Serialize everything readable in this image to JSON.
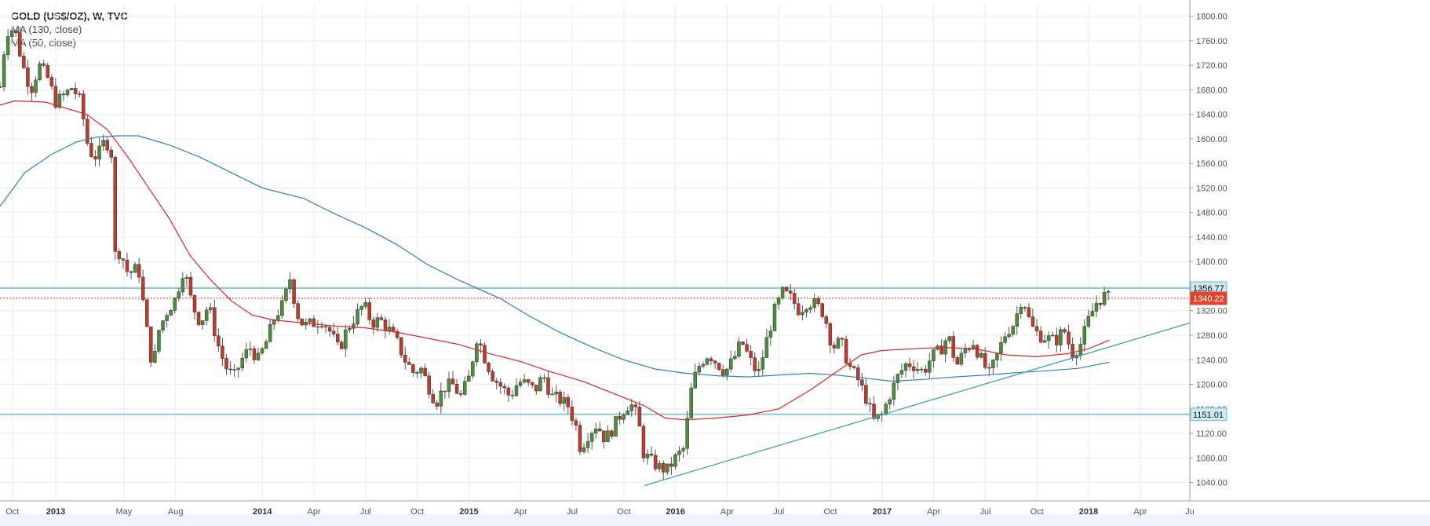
{
  "legend": {
    "title": "GOLD (US$/OZ), W, TVC",
    "ma1": "MA (130, close)",
    "ma2": "MA (50, close)"
  },
  "chart_data": {
    "type": "candlestick",
    "symbol": "GOLD (US$/OZ)",
    "interval": "W",
    "source": "TVC",
    "ylim": [
      1010,
      1820
    ],
    "yticks": [
      1040,
      1080,
      1120,
      1160,
      1200,
      1240,
      1280,
      1320,
      1360,
      1400,
      1440,
      1480,
      1520,
      1560,
      1600,
      1640,
      1680,
      1720,
      1760,
      1800
    ],
    "ytick_labels": [
      "1040.00",
      "1080.00",
      "1120.00",
      "1160.00",
      "1200.00",
      "1240.00",
      "1280.00",
      "1320.00",
      "1360.00",
      "1400.00",
      "1440.00",
      "1480.00",
      "1520.00",
      "1560.00",
      "1600.00",
      "1640.00",
      "1680.00",
      "1720.00",
      "1760.00",
      "1800.00"
    ],
    "xlim": [
      2012.73,
      2018.49
    ],
    "xticks": [
      {
        "t": 2012.79,
        "label": "Oct",
        "year": false
      },
      {
        "t": 2013.0,
        "label": "2013",
        "year": true
      },
      {
        "t": 2013.33,
        "label": "May",
        "year": false
      },
      {
        "t": 2013.58,
        "label": "Aug",
        "year": false
      },
      {
        "t": 2014.0,
        "label": "2014",
        "year": true
      },
      {
        "t": 2014.25,
        "label": "Apr",
        "year": false
      },
      {
        "t": 2014.5,
        "label": "Jul",
        "year": false
      },
      {
        "t": 2014.75,
        "label": "Oct",
        "year": false
      },
      {
        "t": 2015.0,
        "label": "2015",
        "year": true
      },
      {
        "t": 2015.25,
        "label": "Apr",
        "year": false
      },
      {
        "t": 2015.5,
        "label": "Jul",
        "year": false
      },
      {
        "t": 2015.75,
        "label": "Oct",
        "year": false
      },
      {
        "t": 2016.0,
        "label": "2016",
        "year": true
      },
      {
        "t": 2016.25,
        "label": "Apr",
        "year": false
      },
      {
        "t": 2016.5,
        "label": "Jul",
        "year": false
      },
      {
        "t": 2016.75,
        "label": "Oct",
        "year": false
      },
      {
        "t": 2017.0,
        "label": "2017",
        "year": true
      },
      {
        "t": 2017.25,
        "label": "Apr",
        "year": false
      },
      {
        "t": 2017.5,
        "label": "Jul",
        "year": false
      },
      {
        "t": 2017.75,
        "label": "Oct",
        "year": false
      },
      {
        "t": 2018.0,
        "label": "2018",
        "year": true
      },
      {
        "t": 2018.25,
        "label": "Apr",
        "year": false
      },
      {
        "t": 2018.49,
        "label": "Ju",
        "year": false
      }
    ],
    "close_path": [
      [
        2012.73,
        1685
      ],
      [
        2012.76,
        1775
      ],
      [
        2012.8,
        1780
      ],
      [
        2012.84,
        1720
      ],
      [
        2012.88,
        1680
      ],
      [
        2012.92,
        1720
      ],
      [
        2012.96,
        1700
      ],
      [
        2013.0,
        1660
      ],
      [
        2013.04,
        1670
      ],
      [
        2013.08,
        1685
      ],
      [
        2013.12,
        1660
      ],
      [
        2013.16,
        1580
      ],
      [
        2013.2,
        1570
      ],
      [
        2013.24,
        1600
      ],
      [
        2013.27,
        1575
      ],
      [
        2013.29,
        1390
      ],
      [
        2013.31,
        1420
      ],
      [
        2013.35,
        1380
      ],
      [
        2013.4,
        1390
      ],
      [
        2013.44,
        1290
      ],
      [
        2013.47,
        1225
      ],
      [
        2013.5,
        1290
      ],
      [
        2013.54,
        1320
      ],
      [
        2013.58,
        1340
      ],
      [
        2013.62,
        1390
      ],
      [
        2013.66,
        1330
      ],
      [
        2013.7,
        1300
      ],
      [
        2013.74,
        1330
      ],
      [
        2013.78,
        1270
      ],
      [
        2013.82,
        1230
      ],
      [
        2013.86,
        1210
      ],
      [
        2013.9,
        1240
      ],
      [
        2013.94,
        1260
      ],
      [
        2013.98,
        1240
      ],
      [
        2014.02,
        1270
      ],
      [
        2014.06,
        1310
      ],
      [
        2014.1,
        1330
      ],
      [
        2014.14,
        1380
      ],
      [
        2014.16,
        1320
      ],
      [
        2014.2,
        1295
      ],
      [
        2014.25,
        1300
      ],
      [
        2014.29,
        1305
      ],
      [
        2014.33,
        1285
      ],
      [
        2014.37,
        1255
      ],
      [
        2014.41,
        1290
      ],
      [
        2014.45,
        1310
      ],
      [
        2014.49,
        1330
      ],
      [
        2014.53,
        1300
      ],
      [
        2014.57,
        1305
      ],
      [
        2014.61,
        1290
      ],
      [
        2014.65,
        1270
      ],
      [
        2014.69,
        1240
      ],
      [
        2014.73,
        1220
      ],
      [
        2014.77,
        1225
      ],
      [
        2014.8,
        1200
      ],
      [
        2014.84,
        1170
      ],
      [
        2014.88,
        1195
      ],
      [
        2014.92,
        1200
      ],
      [
        2014.96,
        1180
      ],
      [
        2015.0,
        1210
      ],
      [
        2015.04,
        1280
      ],
      [
        2015.08,
        1240
      ],
      [
        2015.12,
        1210
      ],
      [
        2015.16,
        1195
      ],
      [
        2015.2,
        1180
      ],
      [
        2015.24,
        1205
      ],
      [
        2015.28,
        1200
      ],
      [
        2015.32,
        1190
      ],
      [
        2015.36,
        1215
      ],
      [
        2015.4,
        1180
      ],
      [
        2015.44,
        1175
      ],
      [
        2015.48,
        1165
      ],
      [
        2015.52,
        1130
      ],
      [
        2015.54,
        1095
      ],
      [
        2015.58,
        1120
      ],
      [
        2015.62,
        1135
      ],
      [
        2015.66,
        1110
      ],
      [
        2015.7,
        1130
      ],
      [
        2015.74,
        1155
      ],
      [
        2015.78,
        1170
      ],
      [
        2015.82,
        1145
      ],
      [
        2015.84,
        1090
      ],
      [
        2015.88,
        1075
      ],
      [
        2015.92,
        1065
      ],
      [
        2015.96,
        1060
      ],
      [
        2016.0,
        1080
      ],
      [
        2016.04,
        1095
      ],
      [
        2016.08,
        1200
      ],
      [
        2016.12,
        1235
      ],
      [
        2016.16,
        1250
      ],
      [
        2016.2,
        1235
      ],
      [
        2016.24,
        1220
      ],
      [
        2016.28,
        1240
      ],
      [
        2016.32,
        1270
      ],
      [
        2016.36,
        1240
      ],
      [
        2016.4,
        1215
      ],
      [
        2016.44,
        1270
      ],
      [
        2016.48,
        1320
      ],
      [
        2016.52,
        1350
      ],
      [
        2016.56,
        1340
      ],
      [
        2016.6,
        1320
      ],
      [
        2016.64,
        1335
      ],
      [
        2016.68,
        1330
      ],
      [
        2016.72,
        1315
      ],
      [
        2016.76,
        1260
      ],
      [
        2016.8,
        1270
      ],
      [
        2016.84,
        1230
      ],
      [
        2016.88,
        1210
      ],
      [
        2016.92,
        1180
      ],
      [
        2016.96,
        1140
      ],
      [
        2017.0,
        1150
      ],
      [
        2017.04,
        1185
      ],
      [
        2017.08,
        1215
      ],
      [
        2017.12,
        1235
      ],
      [
        2017.16,
        1230
      ],
      [
        2017.2,
        1220
      ],
      [
        2017.24,
        1245
      ],
      [
        2017.28,
        1255
      ],
      [
        2017.32,
        1280
      ],
      [
        2017.36,
        1230
      ],
      [
        2017.4,
        1255
      ],
      [
        2017.44,
        1270
      ],
      [
        2017.48,
        1240
      ],
      [
        2017.52,
        1215
      ],
      [
        2017.56,
        1250
      ],
      [
        2017.6,
        1285
      ],
      [
        2017.64,
        1300
      ],
      [
        2017.68,
        1345
      ],
      [
        2017.72,
        1295
      ],
      [
        2017.76,
        1280
      ],
      [
        2017.8,
        1275
      ],
      [
        2017.84,
        1270
      ],
      [
        2017.88,
        1290
      ],
      [
        2017.92,
        1250
      ],
      [
        2017.96,
        1265
      ],
      [
        2018.0,
        1305
      ],
      [
        2018.04,
        1335
      ],
      [
        2018.08,
        1345
      ],
      [
        2018.1,
        1340
      ]
    ],
    "ma130": [
      [
        2012.73,
        1490
      ],
      [
        2012.85,
        1545
      ],
      [
        2012.98,
        1575
      ],
      [
        2013.1,
        1595
      ],
      [
        2013.2,
        1603
      ],
      [
        2013.3,
        1605
      ],
      [
        2013.4,
        1605
      ],
      [
        2013.55,
        1590
      ],
      [
        2013.7,
        1570
      ],
      [
        2013.85,
        1545
      ],
      [
        2014.0,
        1520
      ],
      [
        2014.2,
        1503
      ],
      [
        2014.35,
        1478
      ],
      [
        2014.5,
        1455
      ],
      [
        2014.65,
        1428
      ],
      [
        2014.8,
        1395
      ],
      [
        2014.95,
        1370
      ],
      [
        2015.15,
        1340
      ],
      [
        2015.3,
        1310
      ],
      [
        2015.45,
        1283
      ],
      [
        2015.6,
        1260
      ],
      [
        2015.75,
        1240
      ],
      [
        2015.9,
        1225
      ],
      [
        2016.05,
        1218
      ],
      [
        2016.2,
        1214
      ],
      [
        2016.35,
        1212
      ],
      [
        2016.5,
        1215
      ],
      [
        2016.65,
        1218
      ],
      [
        2016.78,
        1215
      ],
      [
        2016.92,
        1210
      ],
      [
        2017.05,
        1205
      ],
      [
        2017.2,
        1208
      ],
      [
        2017.35,
        1212
      ],
      [
        2017.5,
        1215
      ],
      [
        2017.65,
        1219
      ],
      [
        2017.8,
        1222
      ],
      [
        2017.95,
        1226
      ],
      [
        2018.1,
        1236
      ]
    ],
    "ma50": [
      [
        2012.73,
        1655
      ],
      [
        2012.8,
        1662
      ],
      [
        2012.95,
        1660
      ],
      [
        2013.05,
        1650
      ],
      [
        2013.15,
        1640
      ],
      [
        2013.25,
        1615
      ],
      [
        2013.35,
        1570
      ],
      [
        2013.45,
        1520
      ],
      [
        2013.55,
        1470
      ],
      [
        2013.65,
        1410
      ],
      [
        2013.75,
        1370
      ],
      [
        2013.85,
        1336
      ],
      [
        2013.95,
        1313
      ],
      [
        2014.05,
        1305
      ],
      [
        2014.2,
        1300
      ],
      [
        2014.35,
        1295
      ],
      [
        2014.5,
        1292
      ],
      [
        2014.65,
        1285
      ],
      [
        2014.8,
        1275
      ],
      [
        2014.95,
        1265
      ],
      [
        2015.1,
        1250
      ],
      [
        2015.25,
        1237
      ],
      [
        2015.4,
        1220
      ],
      [
        2015.55,
        1205
      ],
      [
        2015.7,
        1185
      ],
      [
        2015.85,
        1165
      ],
      [
        2015.95,
        1145
      ],
      [
        2016.05,
        1142
      ],
      [
        2016.2,
        1145
      ],
      [
        2016.35,
        1150
      ],
      [
        2016.5,
        1160
      ],
      [
        2016.65,
        1190
      ],
      [
        2016.8,
        1225
      ],
      [
        2016.9,
        1248
      ],
      [
        2017.0,
        1255
      ],
      [
        2017.15,
        1258
      ],
      [
        2017.3,
        1260
      ],
      [
        2017.45,
        1258
      ],
      [
        2017.6,
        1248
      ],
      [
        2017.75,
        1245
      ],
      [
        2017.9,
        1250
      ],
      [
        2018.0,
        1258
      ],
      [
        2018.1,
        1272
      ]
    ],
    "horizontal_levels": [
      {
        "value": 1356.77,
        "label": "1356.77",
        "color": "#8dcbd6",
        "style": "solid"
      },
      {
        "value": 1151.01,
        "label": "1151.01",
        "color": "#8dcbd6",
        "style": "solid"
      },
      {
        "value": 1340.22,
        "label": "1340.22",
        "color": "#e0441b",
        "style": "dotted"
      }
    ],
    "trendline": {
      "points": [
        [
          2015.85,
          1035
        ],
        [
          2018.49,
          1300
        ]
      ],
      "color": "#3aa7a0"
    },
    "colors": {
      "up": "#4c8c3d",
      "down": "#c0392b",
      "wick": "#555555",
      "ma130": "#2f7fb5",
      "ma50": "#e0252b",
      "grid": "#ececec",
      "badge_level": "#cfe9f0",
      "badge_last": "#e0442c"
    }
  }
}
